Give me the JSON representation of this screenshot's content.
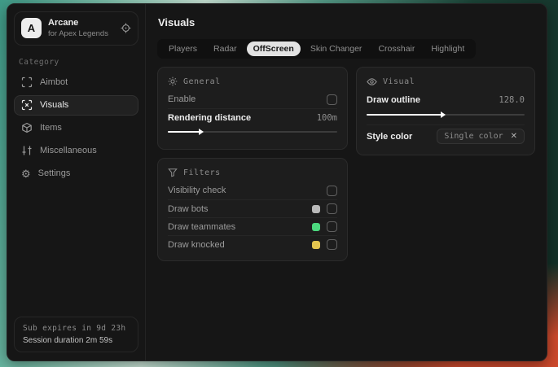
{
  "sidebar": {
    "brand": {
      "initial": "A",
      "name": "Arcane",
      "subtitle": "for Apex Legends"
    },
    "category_label": "Category",
    "items": [
      {
        "label": "Aimbot",
        "icon": "crosshair-icon",
        "active": false
      },
      {
        "label": "Visuals",
        "icon": "focus-scan-icon",
        "active": true
      },
      {
        "label": "Items",
        "icon": "cube-icon",
        "active": false
      },
      {
        "label": "Miscellaneous",
        "icon": "sliders-icon",
        "active": false
      },
      {
        "label": "Settings",
        "icon": "gear-icon",
        "active": false
      }
    ],
    "session": {
      "line1": "Sub expires in 9d 23h",
      "line2": "Session duration 2m 59s"
    }
  },
  "main": {
    "title": "Visuals",
    "tabs": [
      {
        "label": "Players",
        "active": false
      },
      {
        "label": "Radar",
        "active": false
      },
      {
        "label": "OffScreen",
        "active": true
      },
      {
        "label": "Skin Changer",
        "active": false
      },
      {
        "label": "Crosshair",
        "active": false
      },
      {
        "label": "Highlight",
        "active": false
      }
    ],
    "panels": {
      "general": {
        "title": "General",
        "icon": "sun-icon",
        "enable_label": "Enable",
        "enable_checked": false,
        "distance_label": "Rendering distance",
        "distance_value": "100m",
        "distance_percent": 20
      },
      "visual": {
        "title": "Visual",
        "icon": "eye-icon",
        "outline_label": "Draw outline",
        "outline_value": "128.0",
        "outline_percent": 49,
        "style_label": "Style color",
        "style_value": "Single color",
        "style_clear": "✕"
      },
      "filters": {
        "title": "Filters",
        "icon": "funnel-icon",
        "rows": [
          {
            "label": "Visibility check",
            "swatch": null,
            "checked": false
          },
          {
            "label": "Draw bots",
            "swatch": "#b9b9b9",
            "checked": false
          },
          {
            "label": "Draw teammates",
            "swatch": "#4cd97f",
            "checked": false
          },
          {
            "label": "Draw knocked",
            "swatch": "#e3c44f",
            "checked": false
          }
        ]
      }
    }
  },
  "colors": {
    "active_tab_bg": "#e2e2e2",
    "swatch_bots": "#b9b9b9",
    "swatch_teammates": "#4cd97f",
    "swatch_knocked": "#e3c44f"
  },
  "icons": {
    "gear_glyph": "⚙"
  }
}
